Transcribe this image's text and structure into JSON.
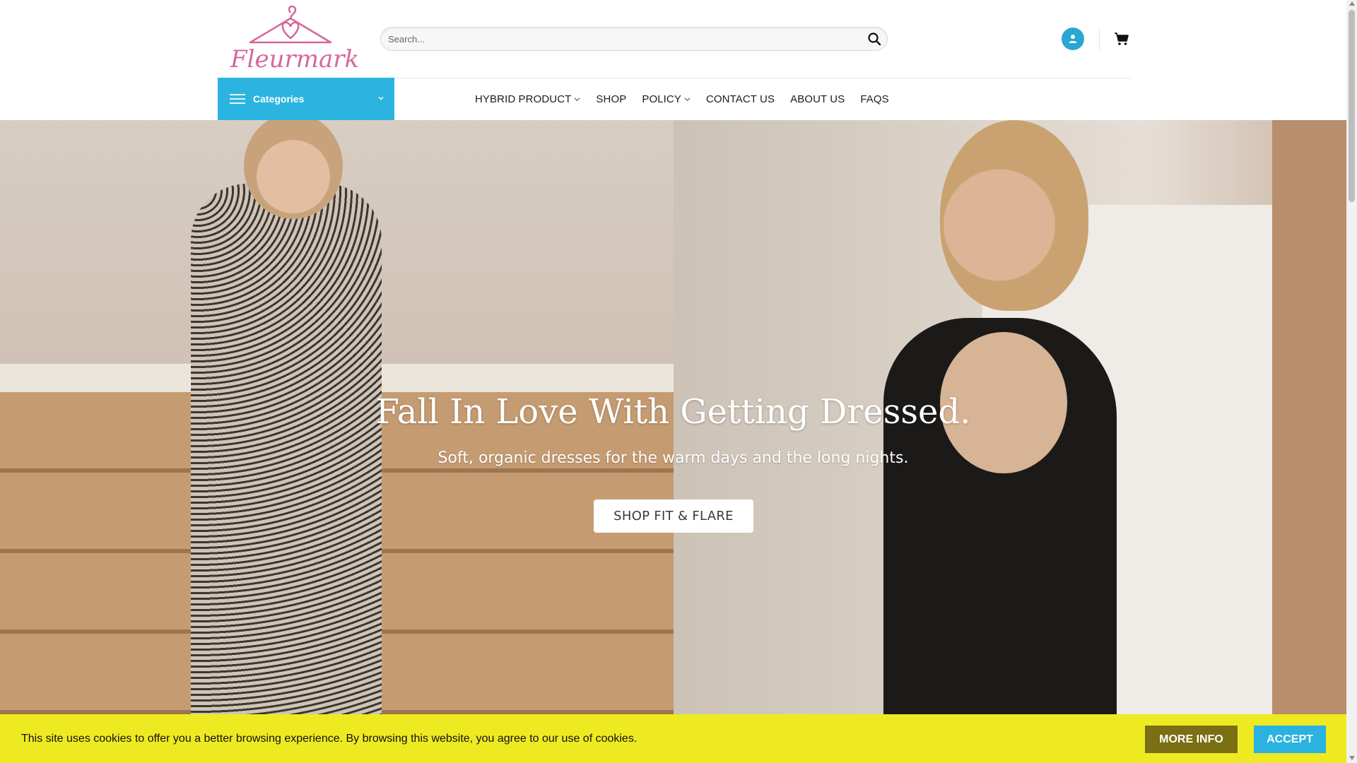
{
  "brand": {
    "name": "Fleurmark",
    "logo_color": "#d6679b"
  },
  "search": {
    "placeholder": "Search...",
    "icon": "search-icon"
  },
  "header_icons": {
    "account": "user-icon",
    "cart": "cart-icon",
    "accent": "#2aa6d2"
  },
  "categories": {
    "label": "Categories",
    "icon": "menu-icon",
    "background": "#2cb4e0"
  },
  "nav": {
    "items": [
      {
        "label": "HYBRID PRODUCT",
        "has_dropdown": true
      },
      {
        "label": "SHOP",
        "has_dropdown": false
      },
      {
        "label": "POLICY",
        "has_dropdown": true
      },
      {
        "label": "CONTACT US",
        "has_dropdown": false
      },
      {
        "label": "ABOUT US",
        "has_dropdown": false
      },
      {
        "label": "FAQS",
        "has_dropdown": false
      }
    ]
  },
  "hero": {
    "title": "Fall In Love With Getting Dressed.",
    "subtitle": "Soft, organic dresses for the warm days and the long nights.",
    "cta_label": "SHOP FIT & FLARE"
  },
  "cookie": {
    "text": "This site uses cookies to offer you a better browsing experience. By browsing this website, you agree to our use of cookies.",
    "more_info_label": "MORE INFO",
    "accept_label": "ACCEPT",
    "background": "#eeea22"
  }
}
